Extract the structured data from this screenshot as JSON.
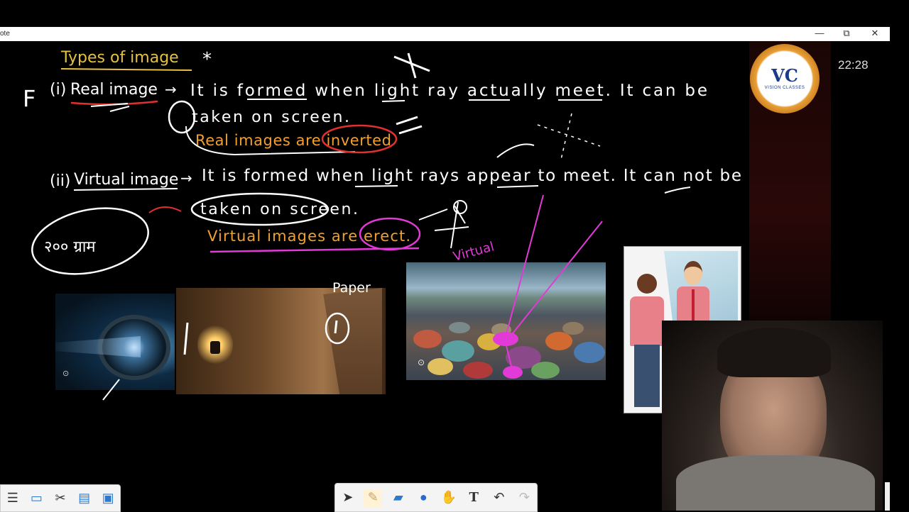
{
  "window": {
    "title": "ote",
    "controls": {
      "minimize": "—",
      "restore": "⧉",
      "close": "✕"
    }
  },
  "clock": "22:28",
  "logo": {
    "monogram": "VC",
    "subtitle": "VISION CLASSES"
  },
  "notes": {
    "heading": "Types of image",
    "heading_mark": "*",
    "margin_mark": "F",
    "real": {
      "number": "(i)",
      "term": "Real image",
      "arrow": "→",
      "line1": "It is formed when light ray actually meet. It can be",
      "line2": "taken on screen.",
      "line3": "Real images are inverted"
    },
    "virtual": {
      "number": "(ii)",
      "term": "Virtual image",
      "arrow": "→",
      "line1": "It is formed when light rays appear to meet. It can not be",
      "line2": "taken on screen.",
      "line3": "Virtual images are erect."
    },
    "scribble_circle": "२०० ग्राम",
    "paper_label": "Paper",
    "virtual_label": "Virtual"
  },
  "colors": {
    "ink_white": "#ffffff",
    "ink_orange": "#f0a030",
    "ink_pink": "#e23ad6",
    "ink_red": "#e03030",
    "heading_yellow": "#e8c040"
  },
  "toolbar": {
    "tools": [
      {
        "name": "select-tool",
        "icon": "cursor-icon"
      },
      {
        "name": "hand-tool",
        "icon": "pen-icon"
      },
      {
        "name": "eraser-tool",
        "icon": "eraser-icon"
      },
      {
        "name": "shape-tool",
        "icon": "circle-icon"
      },
      {
        "name": "pan-tool",
        "icon": "hand-icon"
      },
      {
        "name": "text-tool",
        "icon": "text-icon",
        "label": "T"
      },
      {
        "name": "undo-tool",
        "icon": "undo-icon"
      },
      {
        "name": "redo-tool",
        "icon": "redo-icon"
      }
    ]
  }
}
